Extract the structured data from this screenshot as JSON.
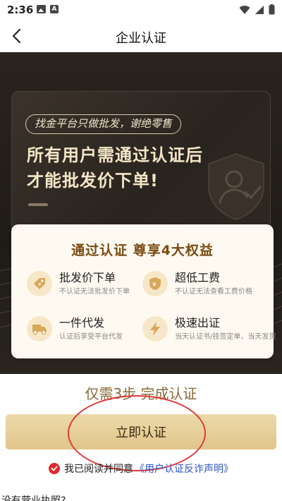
{
  "status_bar": {
    "time": "2:36",
    "icons": [
      "image-icon",
      "a-icon",
      "wifi-icon",
      "signal-icon",
      "battery-icon"
    ]
  },
  "nav": {
    "title": "企业认证",
    "back_icon": "chevron-left-icon"
  },
  "hero": {
    "tagline": "找金平台只做批发，谢绝零售",
    "headline_line1": "所有用户需通过认证后",
    "headline_line2": "才能批发价下单!",
    "decoration_icon": "shield-user-icon"
  },
  "benefits": {
    "title": "通过认证 尊享4大权益",
    "items": [
      {
        "name": "批发价下单",
        "desc": "不认证无法批发价下单",
        "icon": "price-tag-icon"
      },
      {
        "name": "超低工费",
        "desc": "不认证无法查看工费价格",
        "icon": "yen-shield-icon"
      },
      {
        "name": "一件代发",
        "desc": "认证后享受平台代发",
        "icon": "truck-icon"
      },
      {
        "name": "极速出证",
        "desc": "当天认证书/挂签定单，当天发货",
        "icon": "lightning-icon"
      }
    ]
  },
  "steps_text": "仅需3步 完成认证",
  "cta": {
    "label": "立即认证"
  },
  "agreement": {
    "text": "我已阅读并同意",
    "link": "《用户认证反诈声明》",
    "checked": true
  },
  "bottom_peek": "没有营业执照?",
  "colors": {
    "hero_bg": "#221d19",
    "gold_text": "#f3e6c7",
    "cta_gold": "#e7cf98",
    "benefit_title": "#7a4a12",
    "annotation_red": "#e03a3a",
    "link_blue": "#2f56c9"
  }
}
